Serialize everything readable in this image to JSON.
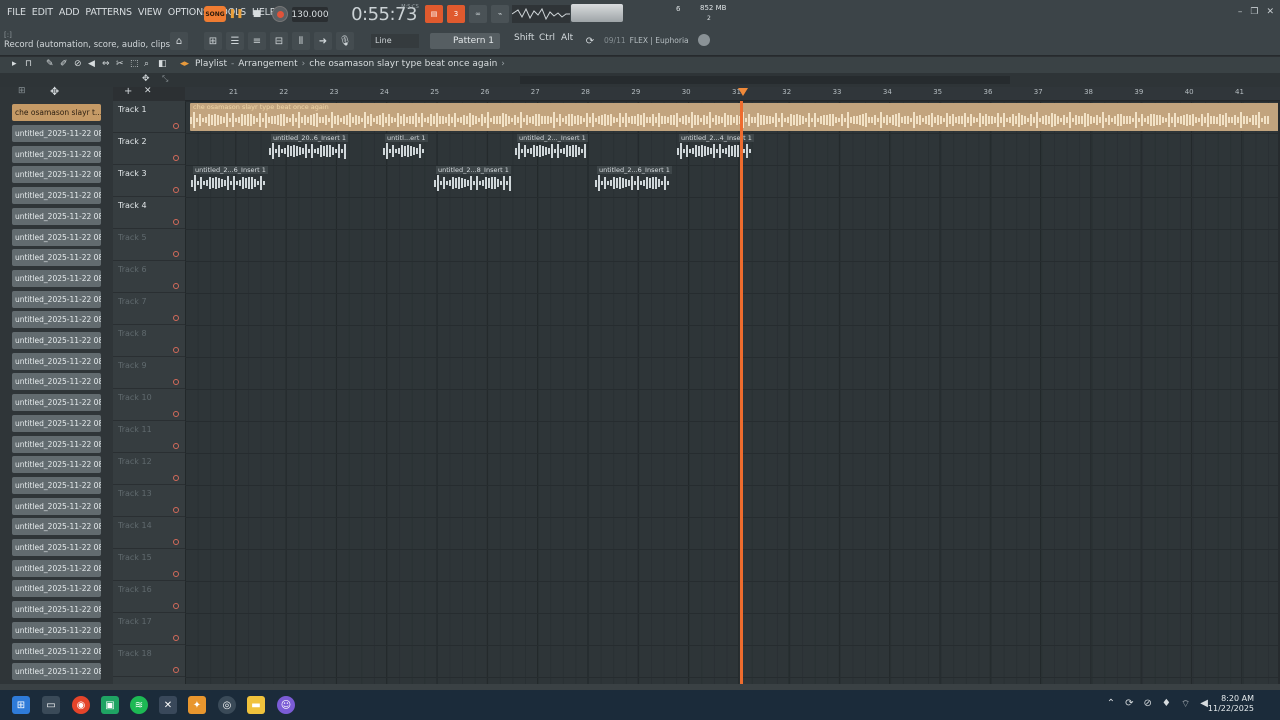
{
  "menu": [
    "FILE",
    "EDIT",
    "ADD",
    "PATTERNS",
    "VIEW",
    "OPTIONS",
    "TOOLS",
    "HELP"
  ],
  "hint": "Record (automation, score, audio, clips)",
  "hint_sub": "[:]",
  "transport": {
    "song_label": "SONG",
    "tempo": "130.000",
    "time": "0:55:73",
    "time_sub": "M:S:CS",
    "cpu": "6",
    "mem": "852 MB",
    "poly": "2"
  },
  "toolbar2": {
    "snap": "Line",
    "pattern": "Pattern 1",
    "shift": "Shift",
    "ctrl": "Ctrl",
    "alt": "Alt",
    "hint_date": "09/11",
    "hint_text": "FLEX | Euphoria"
  },
  "playlist": {
    "title": "Playlist",
    "mode": "Arrangement",
    "song_name": "che osamason slayr type beat once again"
  },
  "ruler_bars": [
    "21",
    "22",
    "23",
    "24",
    "25",
    "26",
    "27",
    "28",
    "29",
    "30",
    "31",
    "32",
    "33",
    "34",
    "35",
    "36",
    "37",
    "38",
    "39",
    "40",
    "41"
  ],
  "picker": {
    "selected": "che osamason slayr t...",
    "items": [
      "untitled_2025-11-22 08-...",
      "untitled_2025-11-22 08-...",
      "untitled_2025-11-22 08-...",
      "untitled_2025-11-22 08-...",
      "untitled_2025-11-22 08-...",
      "untitled_2025-11-22 08-...",
      "untitled_2025-11-22 08-...",
      "untitled_2025-11-22 08-...",
      "untitled_2025-11-22 08-...",
      "untitled_2025-11-22 08-...",
      "untitled_2025-11-22 08-...",
      "untitled_2025-11-22 08-...",
      "untitled_2025-11-22 08-...",
      "untitled_2025-11-22 08-...",
      "untitled_2025-11-22 08-...",
      "untitled_2025-11-22 08-...",
      "untitled_2025-11-22 08-...",
      "untitled_2025-11-22 08-...",
      "untitled_2025-11-22 08-...",
      "untitled_2025-11-22 08-...",
      "untitled_2025-11-22 08-...",
      "untitled_2025-11-22 08-...",
      "untitled_2025-11-22 08-...",
      "untitled_2025-11-22 08-...",
      "untitled_2025-11-22 08-...",
      "untitled_2025-11-22 08-...",
      "untitled_2025-11-22 08-...",
      "untitled_2025-11-22 08-..."
    ]
  },
  "tracks": [
    "Track 1",
    "Track 2",
    "Track 3",
    "Track 4",
    "Track 5",
    "Track 6",
    "Track 7",
    "Track 8",
    "Track 9",
    "Track 10",
    "Track 11",
    "Track 12",
    "Track 13",
    "Track 14",
    "Track 15",
    "Track 16",
    "Track 17",
    "Track 18"
  ],
  "clips": {
    "main": "che osamason slayr type beat once again",
    "track2": [
      "untitled_20..6_Insert 1",
      "untitl...ert 1",
      "untitled_2..._Insert 1",
      "untitled_2...4_Insert 1"
    ],
    "track3": [
      "untitled_2...6_Insert 1",
      "untitled_2...8_Insert 1",
      "untitled_2...6_Insert 1"
    ]
  },
  "clock": {
    "time": "8:20 AM",
    "date": "11/22/2025"
  }
}
